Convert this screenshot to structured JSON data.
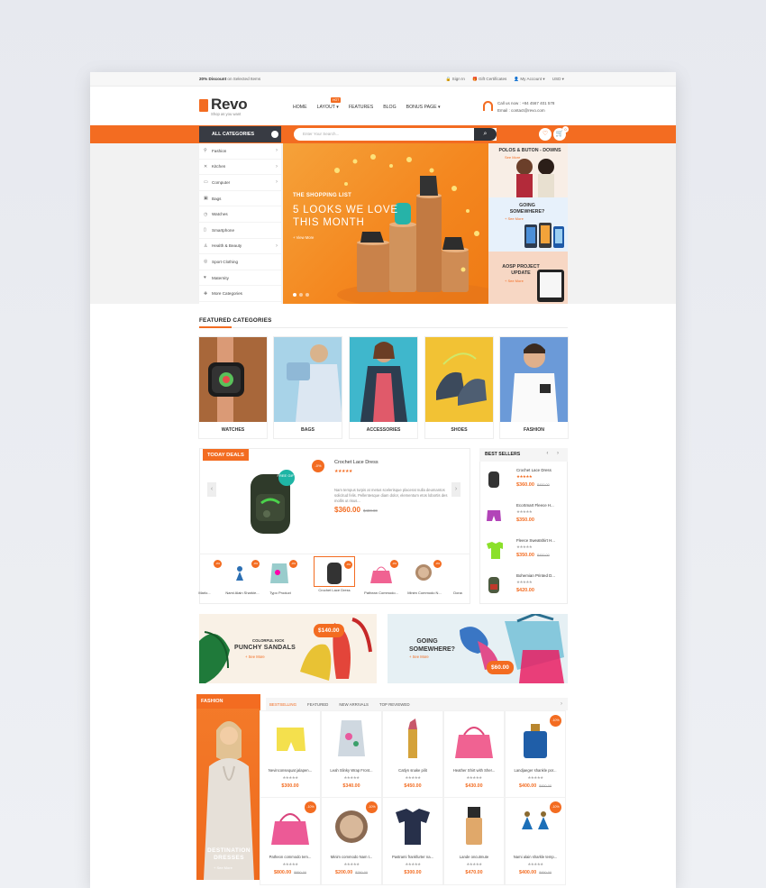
{
  "topbar": {
    "promo_bold": "20% Discount",
    "promo_rest": " on Selected Items",
    "sign_in": "Sign In",
    "gift": "Gift Certificates",
    "account": "My Account",
    "currency": "USD"
  },
  "header": {
    "logo": "Revo",
    "tagline": "Shop as you want",
    "nav": [
      "HOME",
      "LAYOUT",
      "FEATURES",
      "BLOG",
      "BONUS PAGE"
    ],
    "nav_badge": "HOT",
    "contact_line1": "Call us now : +84 4567 401 578",
    "contact_line2": "Email : contact@revo.com"
  },
  "bar": {
    "all_categories": "ALL CATEGORIES",
    "search_placeholder": "Enter Your Search...",
    "cart_count": "0"
  },
  "categories": [
    "Fashion",
    "Kitchen",
    "Computer",
    "Bags",
    "Watches",
    "Smartphone",
    "Health & Beauty",
    "Sport Clothing",
    "Maternity",
    "More Categories"
  ],
  "slider": {
    "kicker": "THE SHOPPING LIST",
    "title": "5 LOOKS WE LOVE THIS MONTH",
    "more": "+ View More"
  },
  "side_banners": {
    "b1_title": "POLOS & BUTON - DOWNS",
    "b1_more": "See More",
    "b2_title": "GOING SOMEWHERE?",
    "b2_more": "+ See More",
    "b3_title": "AOSP PROJECT UPDATE",
    "b3_more": "+ See More"
  },
  "featured": {
    "title": "FEATURED CATEGORIES",
    "items": [
      "WATCHES",
      "BAGS",
      "ACCESSORIES",
      "SHOES",
      "FASHION"
    ]
  },
  "deals": {
    "tag": "TODAY DEALS",
    "gift": "FREE GIFT",
    "discount": "-0%",
    "name": "Crochet Lace Dress",
    "stars": "★★★★★",
    "desc": "Nam tempus turpis at metus scelerisque placerat nulla deumantos solicitud felis. Pellentesque diam dolor, elementum etos lobortis des mollis ut risus...",
    "price": "$360.00",
    "old_price": "$400.00",
    "thumbs": [
      "Marlo...",
      "Nami Alain Sharkie...",
      "Typo Product",
      "Crochet Lace Dress",
      "Pathean Commodo...",
      "Minim Commodo N...",
      "Dona"
    ]
  },
  "best": {
    "title": "BEST SELLERS",
    "items": [
      {
        "name": "Crochet Lace Dress",
        "stars": "★★★★★",
        "price": "$360.00",
        "old": "$400.00"
      },
      {
        "name": "EcoSmart Fleece H...",
        "stars": "★★★★★",
        "price": "$350.00",
        "old": ""
      },
      {
        "name": "Fleece Sweatshirt H...",
        "stars": "★★★★★",
        "price": "$350.00",
        "old": "$400.00"
      },
      {
        "name": "Bohemian Printed D...",
        "stars": "★★★★★",
        "price": "$420.00",
        "old": ""
      }
    ]
  },
  "promos": {
    "p1_kicker": "COLORFUL KICK",
    "p1_title": "PUNCHY SANDALS",
    "p1_more": "+ See More",
    "p1_price": "$140.00",
    "p2_title": "GOING SOMEWHERE?",
    "p2_more": "+ See More",
    "p2_price": "$60.00"
  },
  "fashion": {
    "tag": "FASHION",
    "banner_title": "DESTINATION DRESSES",
    "banner_more": "+ See More",
    "tabs": [
      "BESTSELLING",
      "FEATURED",
      "NEW ARRIVALS",
      "TOP REVIEWED"
    ],
    "products": [
      {
        "name": "Nevinconsequat jalapen...",
        "price": "$300.00",
        "old": "",
        "badge": ""
      },
      {
        "name": "Leah Slinky Wrap Front...",
        "price": "$340.00",
        "old": "",
        "badge": ""
      },
      {
        "name": "Catlyn snake pilit",
        "price": "$450.00",
        "old": "",
        "badge": ""
      },
      {
        "name": "Heather Shirt with Sher...",
        "price": "$430.00",
        "old": "",
        "badge": ""
      },
      {
        "name": "Landjaeger shankle por...",
        "price": "$400.00",
        "old": "$450.00",
        "badge": "-10%"
      },
      {
        "name": "Patheon commodo tem...",
        "price": "$800.00",
        "old": "$850.00",
        "badge": "-10%"
      },
      {
        "name": "Minim commodo Nam t...",
        "price": "$200.00",
        "old": "$250.00",
        "badge": "-10%"
      },
      {
        "name": "Pastrami frankfurter na...",
        "price": "$300.00",
        "old": "",
        "badge": ""
      },
      {
        "name": "Lande oncutmute",
        "price": "$470.00",
        "old": "",
        "badge": ""
      },
      {
        "name": "Nami alain sharkle temp...",
        "price": "$400.00",
        "old": "$450.00",
        "badge": "-10%"
      }
    ],
    "stars": "★★★★★"
  },
  "colors": {
    "accent": "#f36c21",
    "dark": "#383b43"
  }
}
